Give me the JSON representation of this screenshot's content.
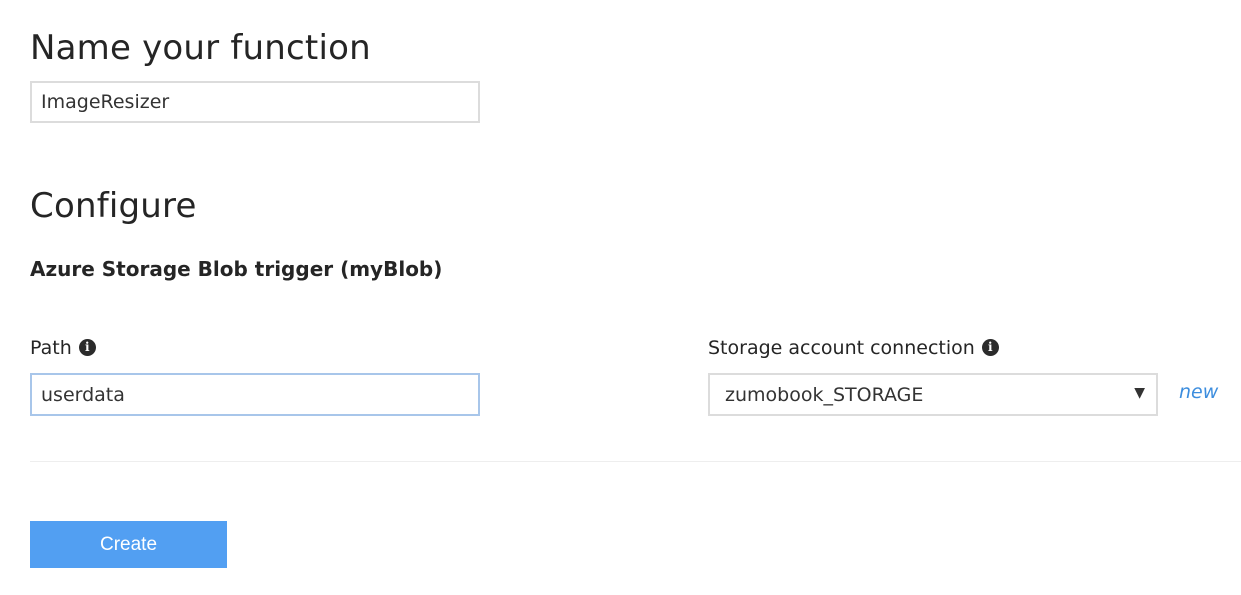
{
  "name_section": {
    "heading": "Name your function",
    "function_name_value": "ImageResizer"
  },
  "configure_section": {
    "heading": "Configure",
    "trigger_title": "Azure Storage Blob trigger (myBlob)",
    "path": {
      "label": "Path",
      "value": "userdata",
      "info_icon": "info-circle-icon"
    },
    "storage_connection": {
      "label": "Storage account connection",
      "selected": "zumobook_STORAGE",
      "caret": "▼",
      "info_icon": "info-circle-icon"
    },
    "new_link": "new"
  },
  "actions": {
    "create_label": "Create"
  },
  "colors": {
    "primary_button": "#529ff2",
    "link": "#3c8dde",
    "focus_border": "#a8c6ea",
    "input_border": "#dcdcdc"
  }
}
